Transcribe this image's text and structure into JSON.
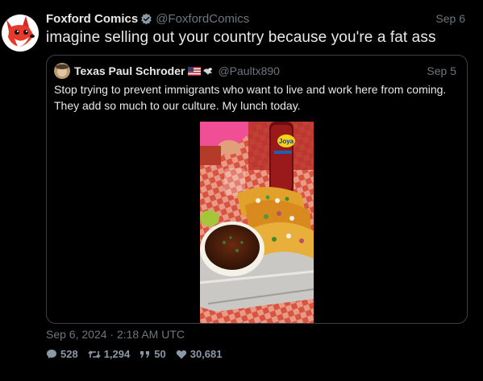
{
  "tweet": {
    "author_name": "Foxford Comics",
    "author_handle": "@FoxfordComics",
    "date": "Sep 6",
    "text": "imagine selling out your country because you're a fat ass",
    "timestamp": "Sep 6, 2024 · 2:18 AM UTC"
  },
  "quote": {
    "author_name": "Texas Paul Schroder",
    "author_handle": "@Paultx890",
    "date": "Sep 5",
    "text": "Stop trying to prevent immigrants who want to live and work here from coming. They add so much to our culture.  My lunch today.",
    "media": {
      "bottle_label": "Joya"
    }
  },
  "stats": {
    "replies": "528",
    "retweets": "1,294",
    "quotes": "50",
    "likes": "30,681"
  },
  "icons": {
    "verified": "verified-badge-icon",
    "reply": "comment-icon",
    "retweet": "retweet-icon",
    "quote": "quote-icon",
    "like": "heart-icon",
    "flag": "us-flag-icon",
    "eagle": "eagle-icon"
  },
  "colors": {
    "background": "#000000",
    "text": "#e7e9ea",
    "muted": "#6e767d",
    "border": "#3b3f44",
    "verified": "#8b98a5"
  }
}
